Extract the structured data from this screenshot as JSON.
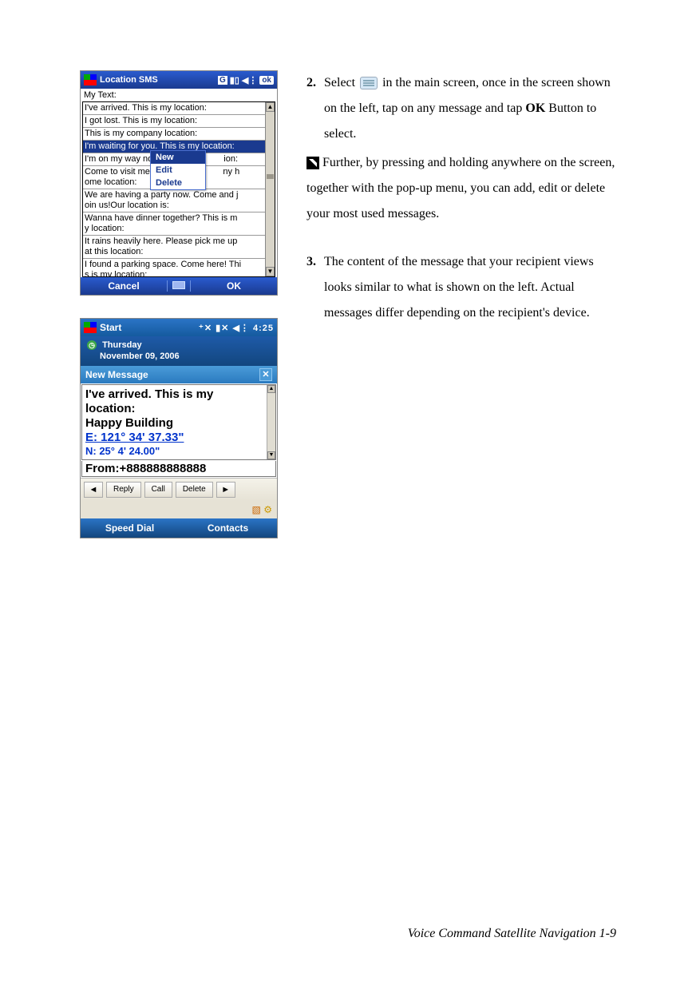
{
  "screenshot1": {
    "title": "Location SMS",
    "status_g": "G",
    "status_ok": "ok",
    "mytext_label": "My Text:",
    "rows": [
      "I've arrived. This is my location:",
      "I got lost. This is my location:",
      "This is my company location:",
      "I'm waiting for you. This is my location:",
      "I'm on my way now. This is my location:",
      "Come to visit me sometime! This is my home location:",
      "We are having a party now. Come and join us!Our location is:",
      "Wanna have dinner together? This is my location:",
      "It rains heavily here. Please pick me up at this location:",
      "I found a parking space. Come here! This is my location:"
    ],
    "popup": {
      "new": "New",
      "edit": "Edit",
      "delete": "Delete"
    },
    "soft_left": "Cancel",
    "soft_right": "OK"
  },
  "screenshot2": {
    "title": "Start",
    "time": "4:25",
    "day": "Thursday",
    "date": "November 09, 2006",
    "new_message": "New Message",
    "body_line1": "I've arrived. This is my",
    "body_line2": " location:",
    "body_line3": "Happy Building",
    "coord1": "E: 121° 34' 37.33\"",
    "coord2": "N: 25° 4' 24.00\"",
    "from_label": "From:",
    "from_number": "+888888888888",
    "btn_reply": "Reply",
    "btn_call": "Call",
    "btn_delete": "Delete",
    "soft_left": "Speed Dial",
    "soft_right": "Contacts"
  },
  "instructions": {
    "step2_num": "2.",
    "step2_a": "Select ",
    "step2_b": " in the main screen, once in the screen shown on the left, tap on any message and tap ",
    "step2_ok": "OK",
    "step2_c": " Button to select.",
    "note": "Further, by pressing and holding anywhere on the screen, together with the pop-up menu, you can add, edit or delete your most used messages.",
    "step3_num": "3.",
    "step3": "The content of the message that your recipient views looks similar to what is shown on the left. Actual messages differ depending on the recipient's device."
  },
  "footer": "Voice Command Satellite Navigation    1-9"
}
